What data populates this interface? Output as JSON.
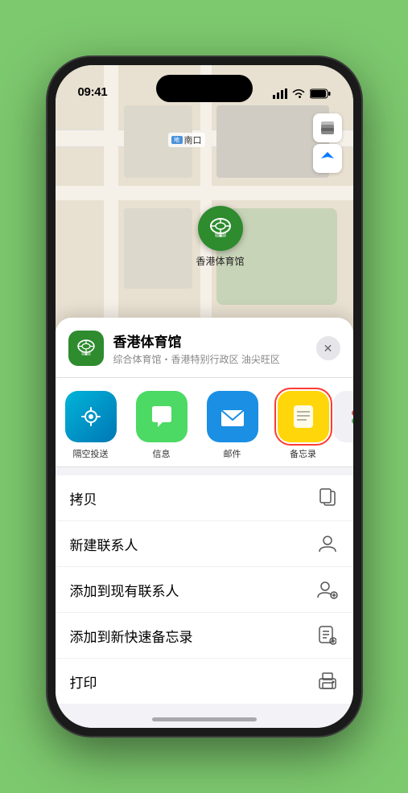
{
  "statusBar": {
    "time": "09:41",
    "locationIcon": "▶"
  },
  "map": {
    "southLabel": "南口",
    "stadiumLabel": "香港体育馆",
    "mapLayerBtn": "🗺",
    "locationBtn": "➤"
  },
  "sheet": {
    "venueName": "香港体育馆",
    "venueSub": "综合体育馆・香港特别行政区 油尖旺区",
    "closeLabel": "✕"
  },
  "shareItems": [
    {
      "id": "airdrop",
      "label": "隔空投送",
      "selected": false
    },
    {
      "id": "message",
      "label": "信息",
      "selected": false
    },
    {
      "id": "mail",
      "label": "邮件",
      "selected": false
    },
    {
      "id": "notes",
      "label": "备忘录",
      "selected": true
    }
  ],
  "actions": [
    {
      "id": "copy",
      "label": "拷贝",
      "icon": "copy"
    },
    {
      "id": "new-contact",
      "label": "新建联系人",
      "icon": "person"
    },
    {
      "id": "add-existing",
      "label": "添加到现有联系人",
      "icon": "person-add"
    },
    {
      "id": "add-notes",
      "label": "添加到新快速备忘录",
      "icon": "note"
    },
    {
      "id": "print",
      "label": "打印",
      "icon": "print"
    }
  ],
  "colors": {
    "green": "#2e8b2e",
    "accent": "#007aff",
    "danger": "#ff3b30"
  }
}
